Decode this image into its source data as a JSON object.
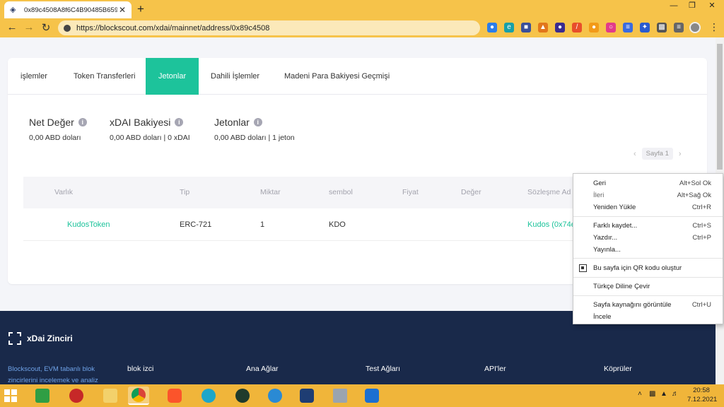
{
  "browser": {
    "tab_title": "0x89c4508A8f6C4B90485B6597",
    "url": "https://blockscout.com/xdai/mainnet/address/0x89c4508"
  },
  "page": {
    "tabs": [
      {
        "label": "işlemler"
      },
      {
        "label": "Token Transferleri"
      },
      {
        "label": "Jetonlar"
      },
      {
        "label": "Dahili İşlemler"
      },
      {
        "label": "Madeni Para Bakiyesi Geçmişi"
      }
    ],
    "stats": [
      {
        "title": "Net Değer",
        "value": "0,00 ABD doları"
      },
      {
        "title": "xDAI Bakiyesi",
        "value": "0,00 ABD doları | 0 xDAI"
      },
      {
        "title": "Jetonlar",
        "value": "0,00 ABD doları | 1 jeton"
      }
    ],
    "pager_label": "Sayfa 1",
    "table": {
      "headers": [
        "Varlık",
        "Tip",
        "Miktar",
        "sembol",
        "Fiyat",
        "Değer",
        "Sözleşme Ad"
      ],
      "row": {
        "asset": "KudosToken",
        "type": "ERC-721",
        "amount": "1",
        "symbol": "KDO",
        "contract": "Kudos (0x74e"
      }
    }
  },
  "footer": {
    "brand": "xDai Zinciri",
    "description": "Blockscout, EVM tabanlı blok zincirlerini incelemek ve analiz",
    "headings": [
      "blok izci",
      "Ana Ağlar",
      "Test Ağları",
      "API'ler",
      "Köprüler"
    ]
  },
  "context_menu": {
    "items": [
      {
        "label": "Geri",
        "shortcut": "Alt+Sol Ok"
      },
      {
        "label": "İleri",
        "shortcut": "Alt+Sağ Ok"
      },
      {
        "label": "Yeniden Yükle",
        "shortcut": "Ctrl+R"
      },
      {
        "label": "Farklı kaydet...",
        "shortcut": "Ctrl+S"
      },
      {
        "label": "Yazdır...",
        "shortcut": "Ctrl+P"
      },
      {
        "label": "Yayınla...",
        "shortcut": ""
      },
      {
        "label": "Bu sayfa için QR kodu oluştur",
        "shortcut": ""
      },
      {
        "label": "Türkçe Diline Çevir",
        "shortcut": ""
      },
      {
        "label": "Sayfa kaynağını görüntüle",
        "shortcut": "Ctrl+U"
      },
      {
        "label": "İncele",
        "shortcut": ""
      }
    ]
  },
  "taskbar": {
    "time": "20:58",
    "date": "7.12.2021"
  },
  "colors": {
    "accent": "#1dc39b",
    "chrome": "#f6c34a",
    "footer": "#19294a"
  }
}
